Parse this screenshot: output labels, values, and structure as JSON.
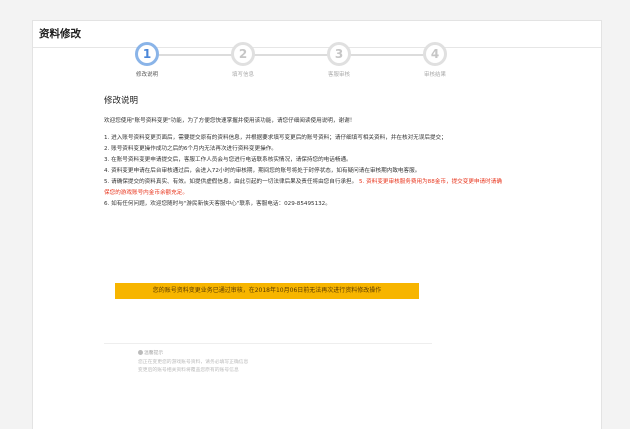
{
  "panel": {
    "title": "资料修改"
  },
  "steps": [
    {
      "number": "1",
      "label": "修改说明",
      "active": true
    },
    {
      "number": "2",
      "label": "填写信息",
      "active": false
    },
    {
      "number": "3",
      "label": "客服审核",
      "active": false
    },
    {
      "number": "4",
      "label": "审核结果",
      "active": false
    }
  ],
  "section": {
    "title": "修改说明"
  },
  "content": {
    "intro": "欢迎您使用\"账号资料变更\"功能，为了方便您快速掌握并使用该功能，请您仔细阅读使用说明，谢谢！",
    "item1": "1. 进入账号资料变更页面后，需要提交原有的资料信息，并根据要求填写变更后的账号资料；请仔细填写相关资料，并在核对无误后提交；",
    "item2": "2. 账号资料变更操作成功之后的6个月内无法再次进行资料变更操作。",
    "item3": "3. 在账号资料变更申请提交后，客服工作人员会与您进行电话联系核实情况，请保持您的电话畅通。",
    "item4": "4. 资料变更申请在后台审核通过后，会进入72小时的审核期，期间您的账号将处于封停状态，如有疑问请在审核期内致电客服。",
    "item5_normal": "5. 请确保提交的资料真实、有效。如提供虚假信息，由此引起的一切法律后果及责任将由您自行承担。",
    "item5_red": "5. 资料变更审核服务费用为88金币，提交变更申请时请确保您的游戏账号内金币余额充足。",
    "item6": "6. 如有任何问题，欢迎您随时与\"游民新侠天客服中心\"联系，客服电话：029-85495132。"
  },
  "notice": {
    "text": "您的账号资料变更业务已通过审核，在2018年10月06日前无法再次进行资料修改操作"
  },
  "tips": {
    "header": "温馨提示",
    "line1": "您正在变更您的游戏账号资料，请务必填写正确信息",
    "line2": "变更后的账号相关资料将覆盖您原有的账号信息"
  },
  "colors": {
    "active_step": "#4a86d8",
    "notice_bg": "#f7b500",
    "highlight_red": "#e8341c"
  }
}
